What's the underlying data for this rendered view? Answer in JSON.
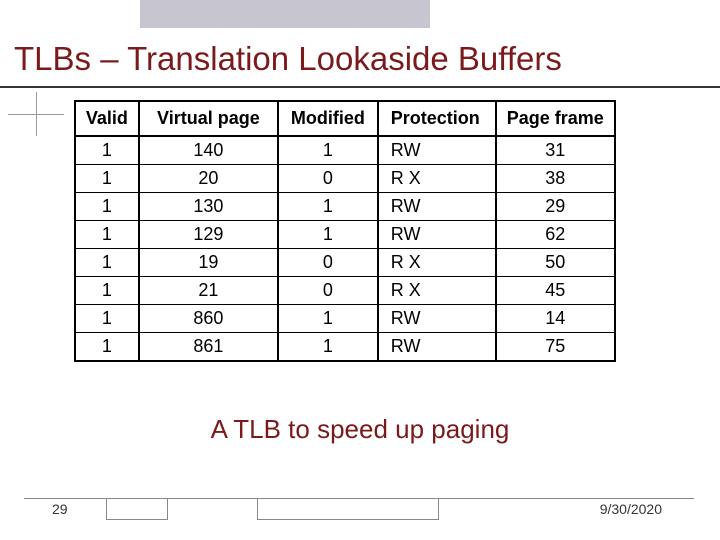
{
  "title": "TLBs – Translation Lookaside Buffers",
  "caption": "A TLB to speed up paging",
  "slide_number": "29",
  "slide_date": "9/30/2020",
  "table": {
    "headers": {
      "valid": "Valid",
      "virtual_page": "Virtual page",
      "modified": "Modified",
      "protection": "Protection",
      "page_frame": "Page frame"
    },
    "rows": [
      {
        "valid": "1",
        "vpage": "140",
        "mod": "1",
        "prot": "RW",
        "frame": "31"
      },
      {
        "valid": "1",
        "vpage": "20",
        "mod": "0",
        "prot": "R X",
        "frame": "38"
      },
      {
        "valid": "1",
        "vpage": "130",
        "mod": "1",
        "prot": "RW",
        "frame": "29"
      },
      {
        "valid": "1",
        "vpage": "129",
        "mod": "1",
        "prot": "RW",
        "frame": "62"
      },
      {
        "valid": "1",
        "vpage": "19",
        "mod": "0",
        "prot": "R X",
        "frame": "50"
      },
      {
        "valid": "1",
        "vpage": "21",
        "mod": "0",
        "prot": "R X",
        "frame": "45"
      },
      {
        "valid": "1",
        "vpage": "860",
        "mod": "1",
        "prot": "RW",
        "frame": "14"
      },
      {
        "valid": "1",
        "vpage": "861",
        "mod": "1",
        "prot": "RW",
        "frame": "75"
      }
    ]
  },
  "chart_data": {
    "type": "table",
    "title": "TLB entries",
    "columns": [
      "Valid",
      "Virtual page",
      "Modified",
      "Protection",
      "Page frame"
    ],
    "rows": [
      [
        1,
        140,
        1,
        "RW",
        31
      ],
      [
        1,
        20,
        0,
        "R X",
        38
      ],
      [
        1,
        130,
        1,
        "RW",
        29
      ],
      [
        1,
        129,
        1,
        "RW",
        62
      ],
      [
        1,
        19,
        0,
        "R X",
        50
      ],
      [
        1,
        21,
        0,
        "R X",
        45
      ],
      [
        1,
        860,
        1,
        "RW",
        14
      ],
      [
        1,
        861,
        1,
        "RW",
        75
      ]
    ]
  }
}
